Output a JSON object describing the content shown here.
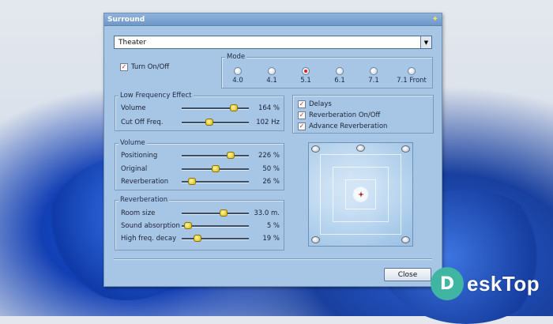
{
  "window": {
    "title": "Surround",
    "title_icon": "pin-icon"
  },
  "preset": {
    "selected": "Theater"
  },
  "turn_on": {
    "label": "Turn On/Off",
    "checked": true
  },
  "mode": {
    "label": "Mode",
    "options": [
      "4.0",
      "4.1",
      "5.1",
      "6.1",
      "7.1",
      "7.1 Front"
    ],
    "selected": "5.1"
  },
  "lfe": {
    "label": "Low Frequency Effect",
    "rows": [
      {
        "label": "Volume",
        "value": "164 %",
        "level": 0.78
      },
      {
        "label": "Cut Off Freq.",
        "value": "102 Hz",
        "level": 0.41
      }
    ]
  },
  "options": {
    "items": [
      {
        "label": "Delays",
        "checked": true
      },
      {
        "label": "Reverberation On/Off",
        "checked": true
      },
      {
        "label": "Advance Reverberation",
        "checked": true
      }
    ]
  },
  "volume": {
    "label": "Volume",
    "rows": [
      {
        "label": "Positioning",
        "value": "226 %",
        "level": 0.73
      },
      {
        "label": "Original",
        "value": "50 %",
        "level": 0.5
      },
      {
        "label": "Reverberation",
        "value": "26 %",
        "level": 0.15
      }
    ]
  },
  "reverb": {
    "label": "Reverberation",
    "rows": [
      {
        "label": "Room size",
        "value": "33.0 m.",
        "level": 0.62
      },
      {
        "label": "Sound absorption",
        "value": "5 %",
        "level": 0.09
      },
      {
        "label": "High freq. decay",
        "value": "19 %",
        "level": 0.24
      }
    ]
  },
  "close_button": {
    "label": "Close"
  },
  "watermark": {
    "logo_letter": "D",
    "text": "eskTop"
  },
  "colors": {
    "window_bg": "#a7c6e6",
    "titlebar": "#7aa2d1",
    "thumb": "#e6c400",
    "selected_radio": "#d4261f"
  }
}
